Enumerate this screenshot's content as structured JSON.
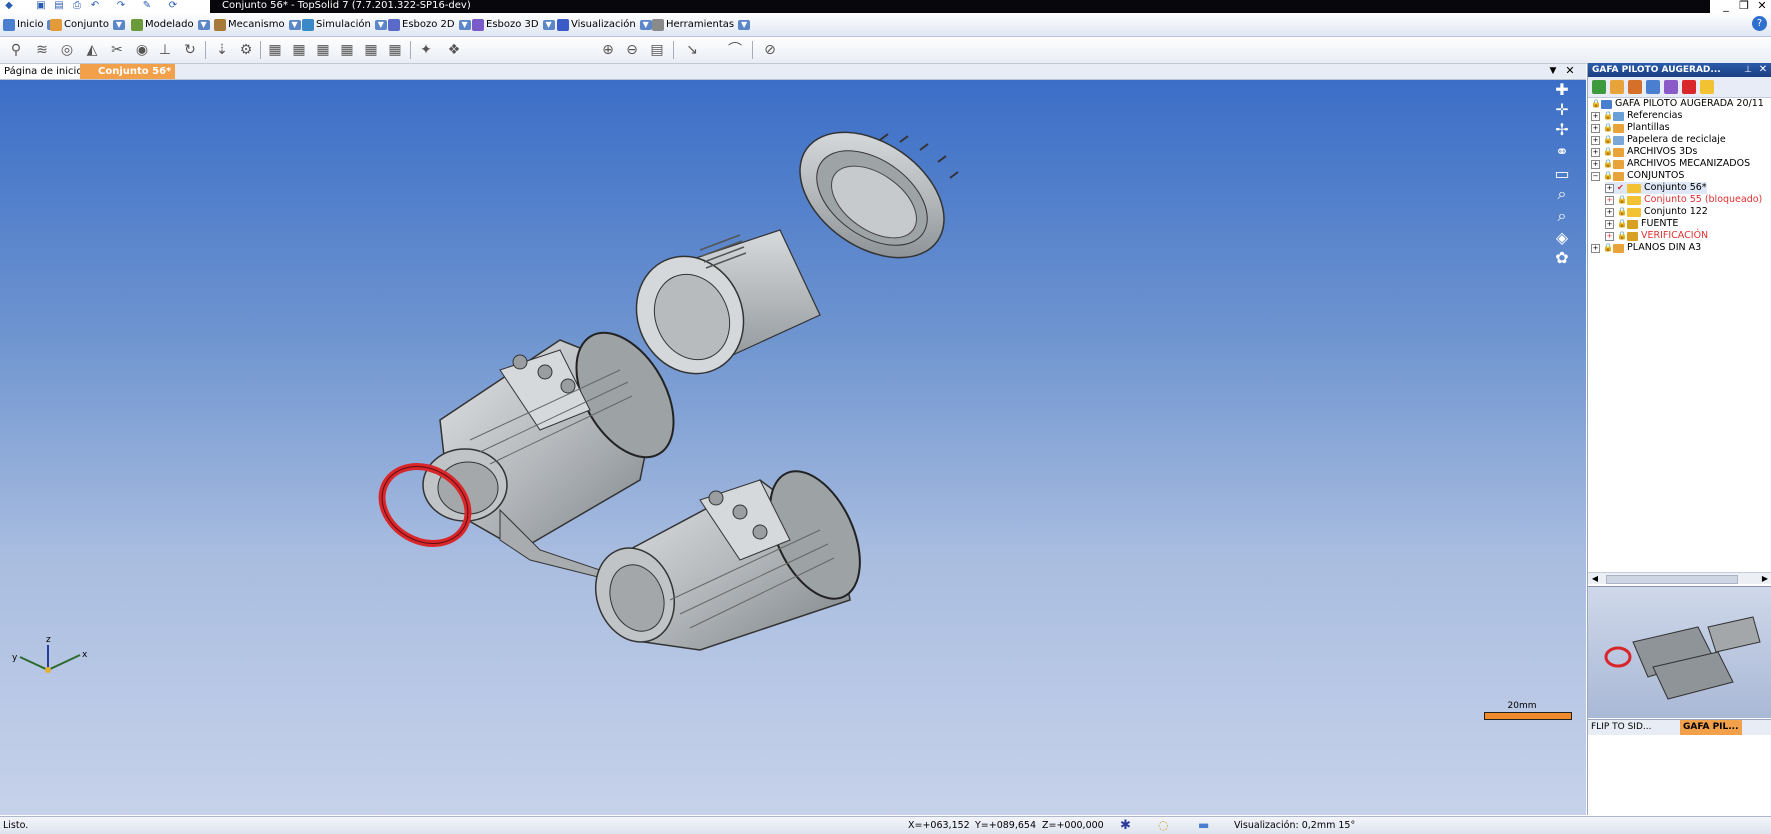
{
  "titlebar": {
    "title": "Conjunto 56* - TopSolid 7 (7.7.201.322-SP16-dev)",
    "minimize": "_",
    "restore": "❐",
    "close": "✕"
  },
  "menubar": {
    "items": [
      {
        "label": "Inicio",
        "icon": "home-icon"
      },
      {
        "label": "Conjunto",
        "icon": "assembly-icon"
      },
      {
        "label": "Modelado",
        "icon": "modeling-icon"
      },
      {
        "label": "Mecanismo",
        "icon": "mechanism-icon"
      },
      {
        "label": "Simulación",
        "icon": "simulation-icon"
      },
      {
        "label": "Esbozo 2D",
        "icon": "sketch2d-icon"
      },
      {
        "label": "Esbozo 3D",
        "icon": "sketch3d-icon"
      },
      {
        "label": "Visualización",
        "icon": "display-icon"
      },
      {
        "label": "Herramientas",
        "icon": "tools-icon"
      }
    ]
  },
  "doctabs": {
    "home": "Página de inicio",
    "active": "Conjunto 56*"
  },
  "viewport": {
    "scale_label": "20mm",
    "axis_x": "x",
    "axis_y": "y",
    "axis_z": "z"
  },
  "panel": {
    "title": "GAFA PILOTO AUGERAD...",
    "tree": [
      {
        "label": "GAFA PILOTO AUGERADA 20/11",
        "level": 0,
        "expander": "",
        "color": "#000000"
      },
      {
        "label": "Referencias",
        "level": 0,
        "expander": "+",
        "color": "#000000"
      },
      {
        "label": "Plantillas",
        "level": 0,
        "expander": "+",
        "color": "#000000"
      },
      {
        "label": "Papelera de reciclaje",
        "level": 0,
        "expander": "+",
        "color": "#000000"
      },
      {
        "label": "ARCHIVOS 3Ds",
        "level": 0,
        "expander": "+",
        "color": "#000000"
      },
      {
        "label": "ARCHIVOS MECANIZADOS",
        "level": 0,
        "expander": "+",
        "color": "#000000"
      },
      {
        "label": "CONJUNTOS",
        "level": 0,
        "expander": "−",
        "color": "#000000"
      },
      {
        "label": "Conjunto 56*",
        "level": 1,
        "expander": "+",
        "color": "#000000"
      },
      {
        "label": "Conjunto 55 (bloqueado)",
        "level": 1,
        "expander": "+",
        "color": "#e03030"
      },
      {
        "label": "Conjunto 122",
        "level": 1,
        "expander": "+",
        "color": "#000000"
      },
      {
        "label": "FUENTE",
        "level": 1,
        "expander": "+",
        "color": "#000000"
      },
      {
        "label": "VERIFICACIÓN",
        "level": 1,
        "expander": "+",
        "color": "#e03030"
      },
      {
        "label": "PLANOS DIN A3",
        "level": 0,
        "expander": "+",
        "color": "#000000"
      }
    ],
    "tabs": [
      "FLIP TO SID...",
      "GAFA PIL..."
    ]
  },
  "statusbar": {
    "status": "Listo.",
    "x": "X=+063,152",
    "y": "Y=+089,654",
    "z": "Z=+000,000",
    "visualization": "Visualización: 0,2mm 15°"
  },
  "colors": {
    "viewport_top": "#3b6ec7",
    "viewport_bottom": "#c7d2ea",
    "part_gray": "#b8bcbf",
    "seal_red": "#d9262a",
    "active_tab": "#f3a04a"
  }
}
